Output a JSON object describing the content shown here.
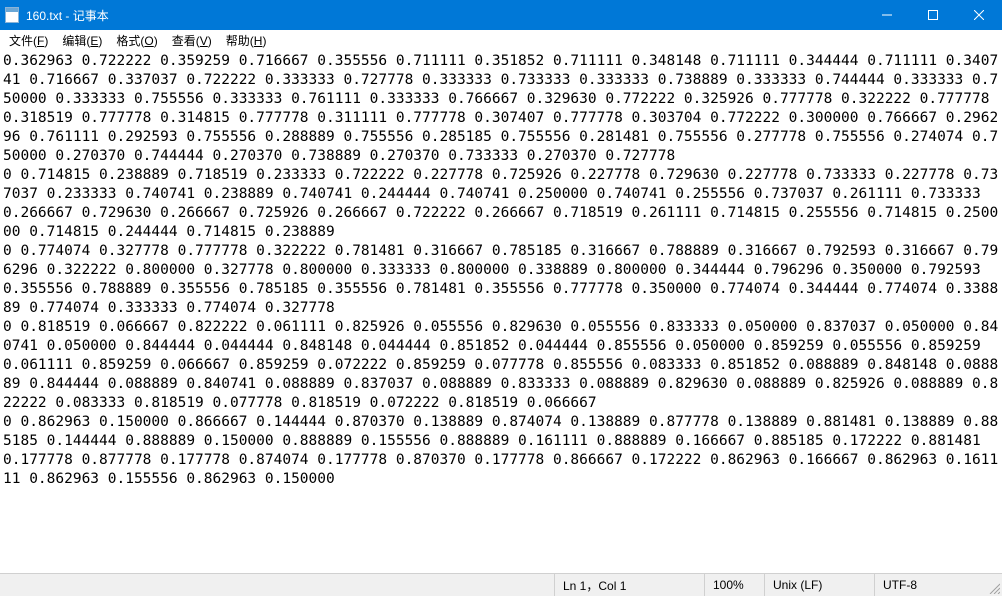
{
  "window": {
    "title": "160.txt - 记事本"
  },
  "menu": {
    "file": {
      "label": "文件",
      "acc": "F"
    },
    "edit": {
      "label": "编辑",
      "acc": "E"
    },
    "format": {
      "label": "格式",
      "acc": "O"
    },
    "view": {
      "label": "查看",
      "acc": "V"
    },
    "help": {
      "label": "帮助",
      "acc": "H"
    }
  },
  "content": "0.362963 0.722222 0.359259 0.716667 0.355556 0.711111 0.351852 0.711111 0.348148 0.711111 0.344444 0.711111 0.340741 0.716667 0.337037 0.722222 0.333333 0.727778 0.333333 0.733333 0.333333 0.738889 0.333333 0.744444 0.333333 0.750000 0.333333 0.755556 0.333333 0.761111 0.333333 0.766667 0.329630 0.772222 0.325926 0.777778 0.322222 0.777778 0.318519 0.777778 0.314815 0.777778 0.311111 0.777778 0.307407 0.777778 0.303704 0.772222 0.300000 0.766667 0.296296 0.761111 0.292593 0.755556 0.288889 0.755556 0.285185 0.755556 0.281481 0.755556 0.277778 0.755556 0.274074 0.750000 0.270370 0.744444 0.270370 0.738889 0.270370 0.733333 0.270370 0.727778\n0 0.714815 0.238889 0.718519 0.233333 0.722222 0.227778 0.725926 0.227778 0.729630 0.227778 0.733333 0.227778 0.737037 0.233333 0.740741 0.238889 0.740741 0.244444 0.740741 0.250000 0.740741 0.255556 0.737037 0.261111 0.733333 0.266667 0.729630 0.266667 0.725926 0.266667 0.722222 0.266667 0.718519 0.261111 0.714815 0.255556 0.714815 0.250000 0.714815 0.244444 0.714815 0.238889\n0 0.774074 0.327778 0.777778 0.322222 0.781481 0.316667 0.785185 0.316667 0.788889 0.316667 0.792593 0.316667 0.796296 0.322222 0.800000 0.327778 0.800000 0.333333 0.800000 0.338889 0.800000 0.344444 0.796296 0.350000 0.792593 0.355556 0.788889 0.355556 0.785185 0.355556 0.781481 0.355556 0.777778 0.350000 0.774074 0.344444 0.774074 0.338889 0.774074 0.333333 0.774074 0.327778\n0 0.818519 0.066667 0.822222 0.061111 0.825926 0.055556 0.829630 0.055556 0.833333 0.050000 0.837037 0.050000 0.840741 0.050000 0.844444 0.044444 0.848148 0.044444 0.851852 0.044444 0.855556 0.050000 0.859259 0.055556 0.859259 0.061111 0.859259 0.066667 0.859259 0.072222 0.859259 0.077778 0.855556 0.083333 0.851852 0.088889 0.848148 0.088889 0.844444 0.088889 0.840741 0.088889 0.837037 0.088889 0.833333 0.088889 0.829630 0.088889 0.825926 0.088889 0.822222 0.083333 0.818519 0.077778 0.818519 0.072222 0.818519 0.066667\n0 0.862963 0.150000 0.866667 0.144444 0.870370 0.138889 0.874074 0.138889 0.877778 0.138889 0.881481 0.138889 0.885185 0.144444 0.888889 0.150000 0.888889 0.155556 0.888889 0.161111 0.888889 0.166667 0.885185 0.172222 0.881481 0.177778 0.877778 0.177778 0.874074 0.177778 0.870370 0.177778 0.866667 0.172222 0.862963 0.166667 0.862963 0.161111 0.862963 0.155556 0.862963 0.150000",
  "status": {
    "pos": "Ln 1，Col 1",
    "zoom": "100%",
    "eol": "Unix (LF)",
    "enc": "UTF-8"
  }
}
